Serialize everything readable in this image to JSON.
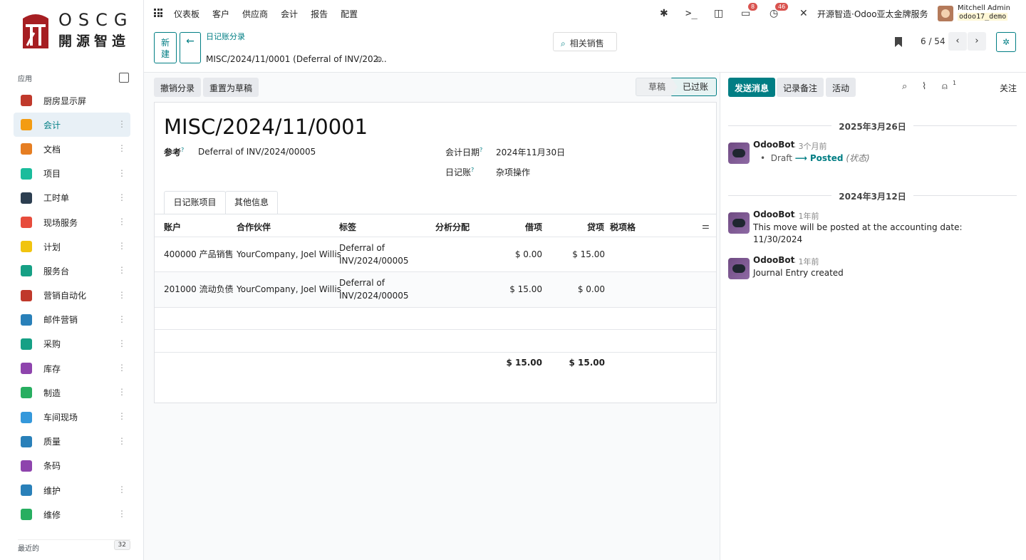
{
  "logo": {
    "line1": "OSCG",
    "line2": "開源智造"
  },
  "sidebar": {
    "apps_label": "应用",
    "recent_label": "最近的",
    "recent_count": "32",
    "items": [
      {
        "label": "厨房显示屏",
        "color": "#c0392b",
        "kebab": false
      },
      {
        "label": "会计",
        "color": "#f39c12",
        "kebab": true,
        "active": true
      },
      {
        "label": "文档",
        "color": "#e67e22",
        "kebab": true
      },
      {
        "label": "项目",
        "color": "#1abc9c",
        "kebab": true
      },
      {
        "label": "工时单",
        "color": "#2c3e50",
        "kebab": true
      },
      {
        "label": "现场服务",
        "color": "#e74c3c",
        "kebab": true
      },
      {
        "label": "计划",
        "color": "#f1c40f",
        "kebab": true
      },
      {
        "label": "服务台",
        "color": "#16a085",
        "kebab": true
      },
      {
        "label": "营销自动化",
        "color": "#c0392b",
        "kebab": true
      },
      {
        "label": "邮件营销",
        "color": "#2980b9",
        "kebab": true
      },
      {
        "label": "采购",
        "color": "#16a085",
        "kebab": true
      },
      {
        "label": "库存",
        "color": "#8e44ad",
        "kebab": true
      },
      {
        "label": "制造",
        "color": "#27ae60",
        "kebab": true
      },
      {
        "label": "车间现场",
        "color": "#3498db",
        "kebab": true
      },
      {
        "label": "质量",
        "color": "#2980b9",
        "kebab": true
      },
      {
        "label": "条码",
        "color": "#8e44ad",
        "kebab": false
      },
      {
        "label": "维护",
        "color": "#2980b9",
        "kebab": true
      },
      {
        "label": "维修",
        "color": "#27ae60",
        "kebab": true
      }
    ]
  },
  "topnav": {
    "menu": [
      "仪表板",
      "客户",
      "供应商",
      "会计",
      "报告",
      "配置"
    ],
    "messages_badge": "8",
    "activities_badge": "46",
    "company": "开源智造·Odoo亚太金牌服务",
    "user_name": "Mitchell Admin",
    "user_db": "odoo17_demo"
  },
  "control": {
    "new_label": "新建",
    "breadcrumb": "日记账分录",
    "record_title": "MISC/2024/11/0001 (Deferral of INV/202...",
    "related_sales": "相关销售",
    "pager": "6 / 54"
  },
  "actions": {
    "cancel_entry": "撤销分录",
    "reset_draft": "重置为草稿"
  },
  "status": {
    "draft": "草稿",
    "posted": "已过账"
  },
  "form": {
    "title": "MISC/2024/11/0001",
    "ref_label": "参考",
    "ref_value": "Deferral of INV/2024/00005",
    "date_label": "会计日期",
    "date_value": "2024年11月30日",
    "journal_label": "日记账",
    "journal_value": "杂项操作",
    "tabs": [
      "日记账项目",
      "其他信息"
    ],
    "columns": {
      "account": "账户",
      "partner": "合作伙伴",
      "label": "标签",
      "analytic": "分析分配",
      "debit": "借项",
      "credit": "贷项",
      "tax_grid": "税项格"
    },
    "lines": [
      {
        "account": "400000 产品销售",
        "partner": "YourCompany, Joel Willis",
        "label1": "Deferral of",
        "label2": "INV/2024/00005",
        "debit": "$ 0.00",
        "credit": "$ 15.00"
      },
      {
        "account": "201000 流动负债",
        "partner": "YourCompany, Joel Willis",
        "label1": "Deferral of",
        "label2": "INV/2024/00005",
        "debit": "$ 15.00",
        "credit": "$ 0.00"
      }
    ],
    "total_debit": "$ 15.00",
    "total_credit": "$ 15.00"
  },
  "chatter": {
    "send_message": "发送消息",
    "log_note": "记录备注",
    "activity": "活动",
    "follower_count": "1",
    "follow": "关注",
    "date1": "2025年3月26日",
    "date2": "2024年3月12日",
    "messages": [
      {
        "author": "OdooBot",
        "time": "- 3个月前",
        "old": "Draft",
        "arrow": "⟶",
        "new": "Posted",
        "field": "(状态)"
      },
      {
        "author": "OdooBot",
        "time": "- 1年前",
        "body1": "This move will be posted at the accounting date:",
        "body2": "11/30/2024"
      },
      {
        "author": "OdooBot",
        "time": "- 1年前",
        "body1": "Journal Entry created"
      }
    ]
  }
}
